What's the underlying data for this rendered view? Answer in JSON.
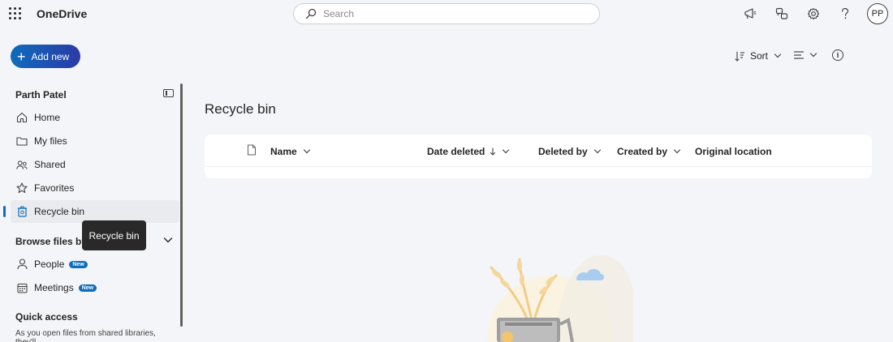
{
  "app": {
    "title": "OneDrive"
  },
  "search": {
    "placeholder": "Search"
  },
  "header": {
    "icons": [
      "megaphone-icon",
      "feedback-icon",
      "settings-icon",
      "help-icon"
    ],
    "avatar_initials": "PP"
  },
  "add_new": {
    "label": "Add new"
  },
  "sidebar": {
    "user_name": "Parth Patel",
    "items": [
      {
        "label": "Home",
        "icon": "home-icon"
      },
      {
        "label": "My files",
        "icon": "folder-icon"
      },
      {
        "label": "Shared",
        "icon": "people-icon"
      },
      {
        "label": "Favorites",
        "icon": "star-icon"
      },
      {
        "label": "Recycle bin",
        "icon": "recycle-bin-icon",
        "active": true
      }
    ],
    "browse_heading": "Browse files by",
    "browse_items": [
      {
        "label": "People",
        "badge": "New",
        "icon": "person-icon"
      },
      {
        "label": "Meetings",
        "badge": "New",
        "icon": "calendar-icon"
      }
    ],
    "quick_access_heading": "Quick access",
    "quick_access_desc": "As you open files from shared libraries, they'll"
  },
  "tooltip": {
    "text": "Recycle bin"
  },
  "main": {
    "title": "Recycle bin",
    "commands": {
      "sort_label": "Sort"
    },
    "columns": [
      "Name",
      "Date deleted",
      "Deleted by",
      "Created by",
      "Original location"
    ]
  },
  "colors": {
    "accent": "#0f6cbd",
    "brand_gradient_end": "#2b3aa6"
  }
}
